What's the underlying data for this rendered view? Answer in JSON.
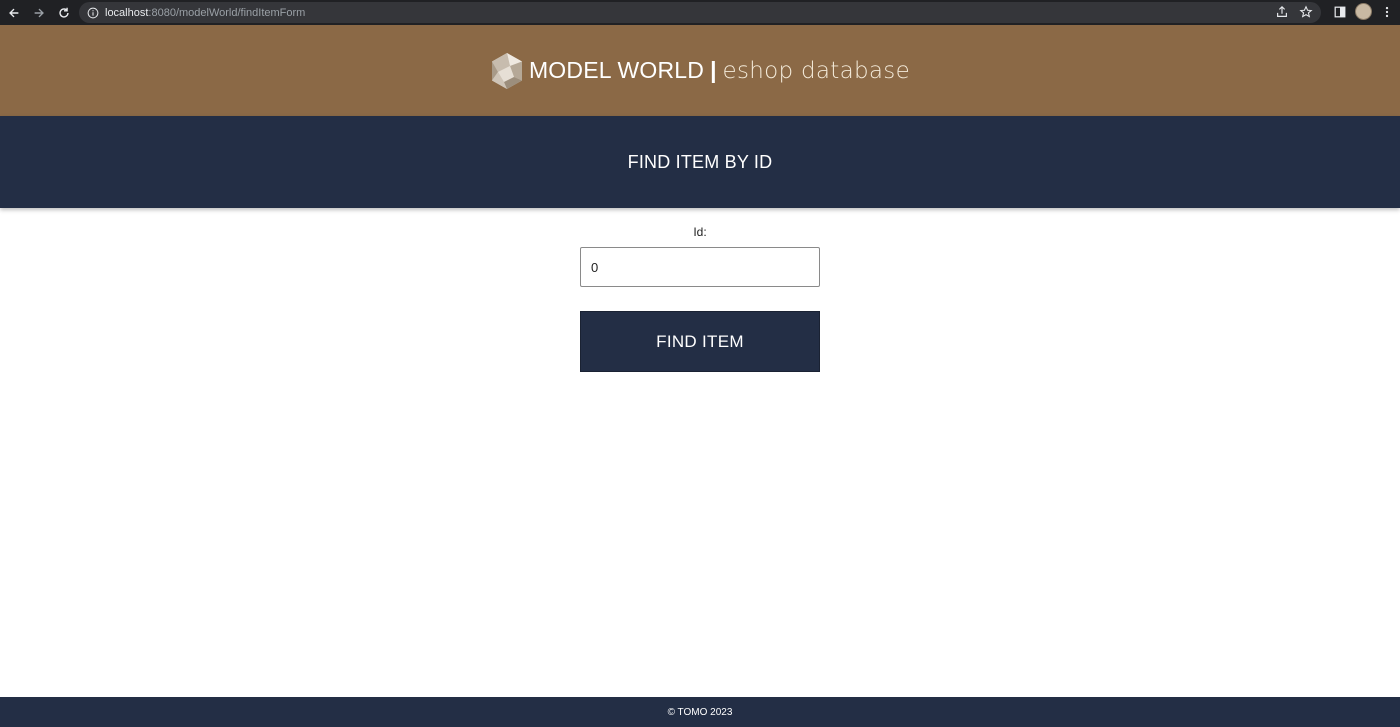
{
  "browser": {
    "url_host": "localhost",
    "url_path": ":8080/modelWorld/findItemForm",
    "icons": [
      "back-icon",
      "forward-icon",
      "reload-icon",
      "info-icon",
      "share-icon",
      "star-icon",
      "side-panel-icon",
      "kebab-menu-icon"
    ]
  },
  "header": {
    "brand_strong": "MODEL WORLD",
    "brand_separator": "|",
    "brand_light": "eshop database",
    "logo_icon": "polyhedron-logo"
  },
  "title_band": {
    "title": "FIND ITEM BY ID"
  },
  "form": {
    "id_label": "Id:",
    "id_value": "0",
    "submit_label": "FIND ITEM"
  },
  "footer": {
    "text": "© TOMO 2023"
  },
  "colors": {
    "brand_band": "#8b6946",
    "navy": "#232e45",
    "chrome": "#202124"
  }
}
